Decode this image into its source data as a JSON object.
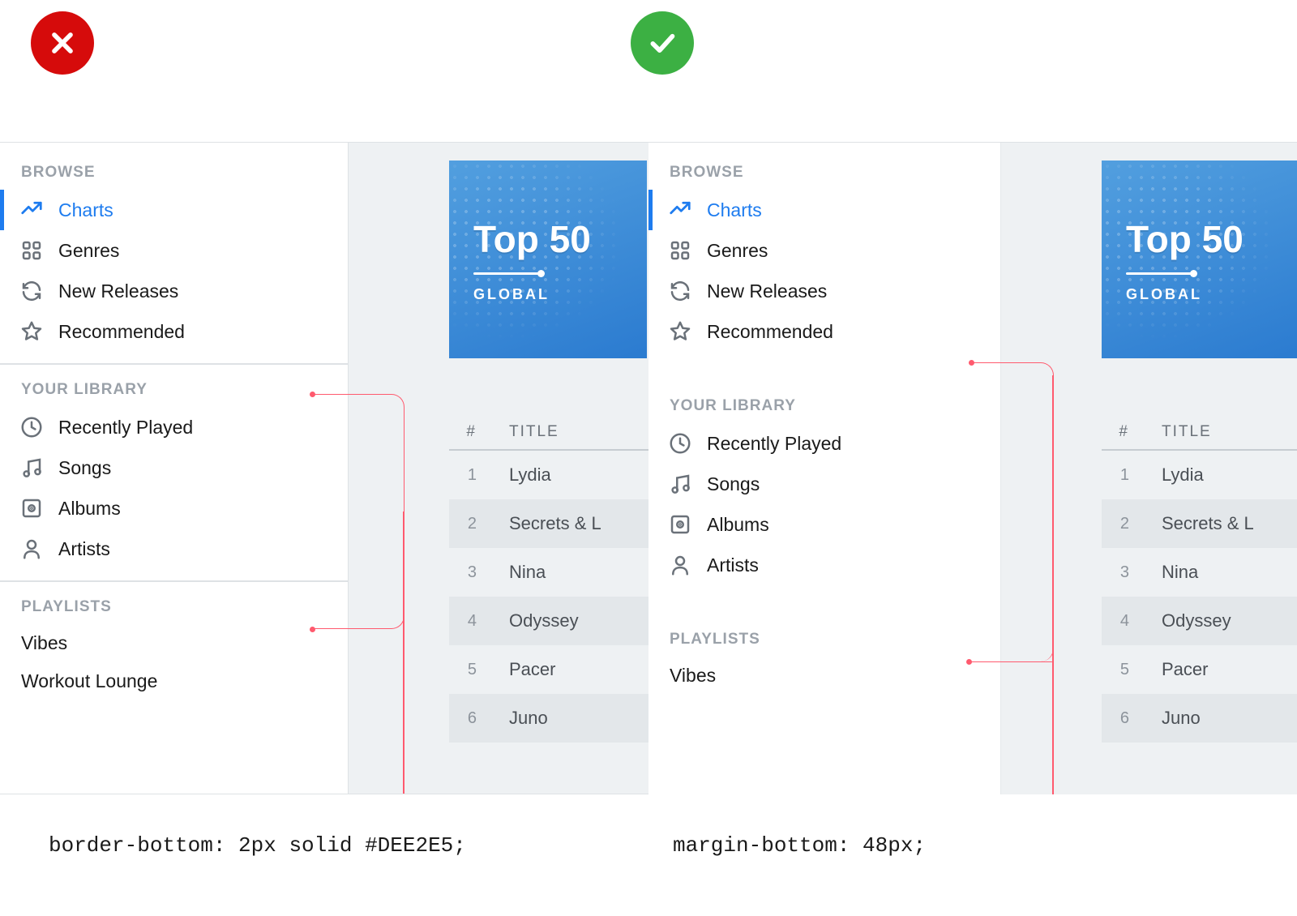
{
  "badge_x_color": "#D60B0B",
  "badge_check_color": "#3CB043",
  "sidebar": {
    "sections": [
      {
        "header": "BROWSE",
        "items": [
          "Charts",
          "Genres",
          "New Releases",
          "Recommended"
        ]
      },
      {
        "header": "YOUR LIBRARY",
        "items": [
          "Recently Played",
          "Songs",
          "Albums",
          "Artists"
        ]
      },
      {
        "header": "PLAYLISTS",
        "items": [
          "Vibes",
          "Workout Lounge"
        ]
      }
    ]
  },
  "album": {
    "title": "Top 50",
    "subtitle": "GLOBAL"
  },
  "tracklist": {
    "columns": {
      "num": "#",
      "title": "TITLE"
    },
    "rows": [
      {
        "num": 1,
        "title": "Lydia"
      },
      {
        "num": 2,
        "title": "Secrets & L"
      },
      {
        "num": 3,
        "title": "Nina"
      },
      {
        "num": 4,
        "title": "Odyssey"
      },
      {
        "num": 5,
        "title": "Pacer"
      },
      {
        "num": 6,
        "title": "Juno"
      }
    ]
  },
  "captions": {
    "left": "border-bottom: 2px solid #DEE2E5;",
    "right": "margin-bottom: 48px;"
  },
  "right_playlists_visible": [
    "Vibes"
  ]
}
